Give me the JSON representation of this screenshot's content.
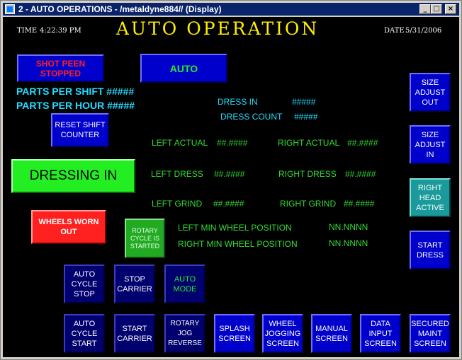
{
  "window": {
    "title": "2 - AUTO OPERATIONS - /metaldyne884// (Display)",
    "controls": {
      "minimize": "_",
      "maximize": "□",
      "close": "×"
    }
  },
  "header": {
    "time_label": "TIME",
    "time_value": "4:22:39 PM",
    "title": "AUTO OPERATION",
    "date_label": "DATE",
    "date_value": "5/31/2006"
  },
  "status": {
    "shot_peen": "SHOT PEEN\nSTOPPED",
    "mode": "AUTO",
    "parts_per_shift": "PARTS PER SHIFT #####",
    "parts_per_hour": "PARTS PER HOUR #####",
    "dressing_in": "DRESSING IN",
    "wheels_worn": "WHEELS WORN\nOUT",
    "rotary_cycle": "ROTARY\nCYCLE IS\nSTARTED",
    "right_head_active": "RIGHT\nHEAD\nACTIVE",
    "auto_mode": "AUTO\nMODE"
  },
  "readouts": {
    "dress_in_label": "DRESS IN",
    "dress_in_value": "#####",
    "dress_count_label": "DRESS COUNT",
    "dress_count_value": "#####",
    "left_actual_label": "LEFT ACTUAL",
    "left_actual_value": "##.####",
    "right_actual_label": "RIGHT ACTUAL",
    "right_actual_value": "##.####",
    "left_dress_label": "LEFT DRESS",
    "left_dress_value": "##.####",
    "right_dress_label": "RIGHT DRESS",
    "right_dress_value": "##.####",
    "left_grind_label": "LEFT GRIND",
    "left_grind_value": "##.####",
    "right_grind_label": "RIGHT GRIND",
    "right_grind_value": "##.####",
    "left_min_label": "LEFT MIN WHEEL POSITION",
    "left_min_value": "NN.NNNN",
    "right_min_label": "RIGHT MIN WHEEL POSITION",
    "right_min_value": "NN.NNNN"
  },
  "buttons": {
    "reset_shift_counter": "RESET SHIFT\nCOUNTER",
    "size_adjust_out": "SIZE\nADJUST\nOUT",
    "size_adjust_in": "SIZE\nADJUST\nIN",
    "start_dress": "START\nDRESS",
    "auto_cycle_stop": "AUTO\nCYCLE\nSTOP",
    "stop_carrier": "STOP\nCARRIER",
    "auto_cycle_start": "AUTO\nCYCLE\nSTART",
    "start_carrier": "START\nCARRIER",
    "rotary_jog_reverse": "ROTARY\nJOG\nREVERSE",
    "splash_screen": "SPLASH\nSCREEN",
    "wheel_jogging_screen": "WHEEL\nJOGGING\nSCREEN",
    "manual_screen": "MANUAL\nSCREEN",
    "data_input_screen": "DATA\nINPUT\nSCREEN",
    "secured_maint_screen": "SECURED\nMAINT\nSCREEN"
  },
  "colors": {
    "screen_bg": "#000000",
    "button_blue": "#0000cc",
    "readout_green": "#33dd33",
    "parts_cyan": "#22ddff",
    "title_yellow": "#ffee00",
    "alarm_red": "#ff2020",
    "active_green": "#22ee22",
    "active_teal": "#1a9a9a"
  }
}
